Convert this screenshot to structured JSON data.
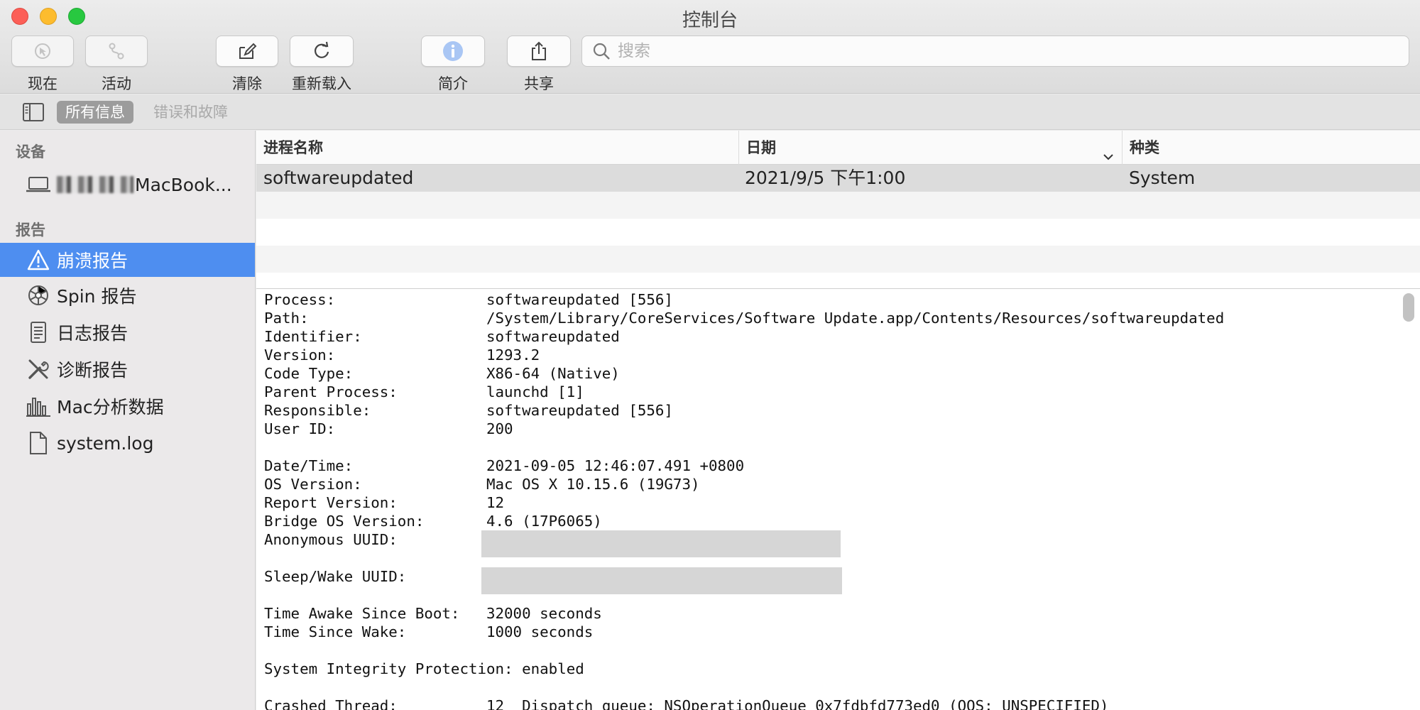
{
  "window": {
    "title": "控制台"
  },
  "toolbar": {
    "now_label": "现在",
    "activity_label": "活动",
    "clear_label": "清除",
    "reload_label": "重新载入",
    "info_label": "简介",
    "share_label": "共享",
    "search_placeholder": "搜索"
  },
  "filter": {
    "all": "所有信息",
    "errors": "错误和故障"
  },
  "sidebar": {
    "devices_header": "设备",
    "device_name": "MacBook...",
    "reports_header": "报告",
    "items": [
      {
        "label": "崩溃报告",
        "icon": "warning-icon"
      },
      {
        "label": "Spin 报告",
        "icon": "spin-icon"
      },
      {
        "label": "日志报告",
        "icon": "log-icon"
      },
      {
        "label": "诊断报告",
        "icon": "tools-icon"
      },
      {
        "label": "Mac分析数据",
        "icon": "chart-icon"
      },
      {
        "label": "system.log",
        "icon": "file-icon"
      }
    ]
  },
  "table": {
    "columns": [
      "进程名称",
      "日期",
      "种类"
    ],
    "rows": [
      {
        "process": "softwareupdated",
        "date": "2021/9/5 下午1:00",
        "kind": "System"
      }
    ]
  },
  "report": {
    "lines": [
      {
        "key": "Process:",
        "value": "softwareupdated [556]"
      },
      {
        "key": "Path:",
        "value": "/System/Library/CoreServices/Software Update.app/Contents/Resources/softwareupdated"
      },
      {
        "key": "Identifier:",
        "value": "softwareupdated"
      },
      {
        "key": "Version:",
        "value": "1293.2"
      },
      {
        "key": "Code Type:",
        "value": "X86-64 (Native)"
      },
      {
        "key": "Parent Process:",
        "value": "launchd [1]"
      },
      {
        "key": "Responsible:",
        "value": "softwareupdated [556]"
      },
      {
        "key": "User ID:",
        "value": "200"
      },
      {
        "key": "Date/Time:",
        "value": "2021-09-05 12:46:07.491 +0800"
      },
      {
        "key": "OS Version:",
        "value": "Mac OS X 10.15.6 (19G73)"
      },
      {
        "key": "Report Version:",
        "value": "12"
      },
      {
        "key": "Bridge OS Version:",
        "value": "4.6 (17P6065)"
      },
      {
        "key": "Anonymous UUID:",
        "value": ""
      },
      {
        "key": "Sleep/Wake UUID:",
        "value": ""
      },
      {
        "key": "Time Awake Since Boot:",
        "value": "32000 seconds"
      },
      {
        "key": "Time Since Wake:",
        "value": "1000 seconds"
      },
      {
        "key": "System Integrity Protection:",
        "value": "enabled"
      },
      {
        "key": "Crashed Thread:",
        "value": "12  Dispatch queue: NSOperationQueue 0x7fdbfd773ed0 (QOS: UNSPECIFIED)"
      }
    ]
  }
}
